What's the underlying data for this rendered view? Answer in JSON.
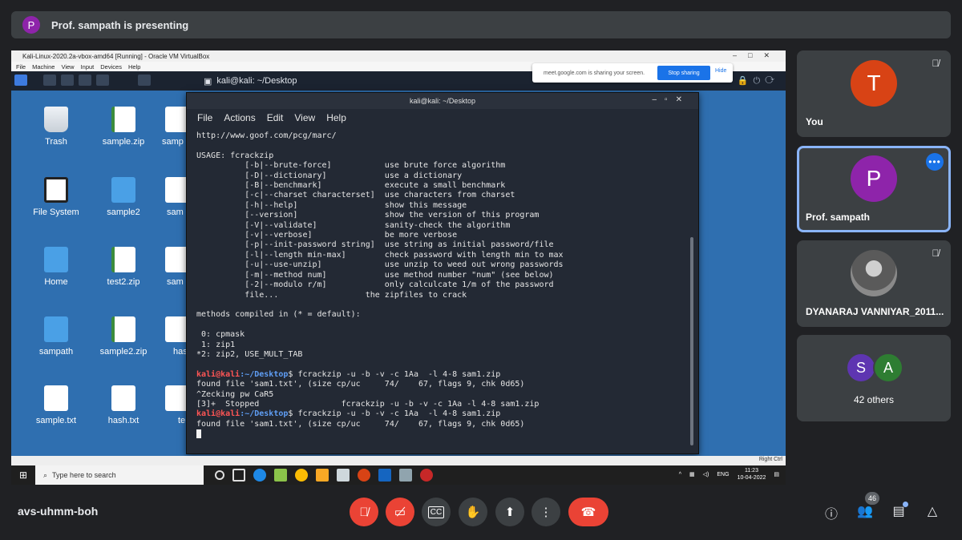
{
  "banner": {
    "avatar_letter": "P",
    "text": "Prof. sampath is presenting"
  },
  "vbox": {
    "title": "Kali-Linux-2020.2a-vbox-amd64 [Running] - Oracle VM VirtualBox",
    "menu": [
      "File",
      "Machine",
      "View",
      "Input",
      "Devices",
      "Help"
    ],
    "status_host_key": "Right Ctrl"
  },
  "kali_panel": {
    "task_title": "kali@kali: ~/Desktop"
  },
  "share_notice": {
    "text": "meet.google.com is sharing your screen.",
    "stop": "Stop sharing",
    "hide": "Hide"
  },
  "desktop_icons": [
    {
      "label": "Trash",
      "type": "trash"
    },
    {
      "label": "sample.zip",
      "type": "zip"
    },
    {
      "label": "samp",
      "type": "doc"
    },
    {
      "label": "File System",
      "type": "fs"
    },
    {
      "label": "sample2",
      "type": "folder"
    },
    {
      "label": "sam",
      "type": "doc"
    },
    {
      "label": "Home",
      "type": "home"
    },
    {
      "label": "test2.zip",
      "type": "zip"
    },
    {
      "label": "sam",
      "type": "doc"
    },
    {
      "label": "sampath",
      "type": "folder"
    },
    {
      "label": "sample2.zip",
      "type": "zip"
    },
    {
      "label": "has",
      "type": "doc"
    },
    {
      "label": "sample.txt",
      "type": "doc"
    },
    {
      "label": "hash.txt",
      "type": "doc"
    },
    {
      "label": "te",
      "type": "doc"
    }
  ],
  "terminal": {
    "title": "kali@kali: ~/Desktop",
    "menu": [
      "File",
      "Actions",
      "Edit",
      "View",
      "Help"
    ],
    "lines": [
      "http://www.goof.com/pcg/marc/",
      "",
      "USAGE: fcrackzip",
      "          [-b|--brute-force]           use brute force algorithm",
      "          [-D|--dictionary]            use a dictionary",
      "          [-B|--benchmark]             execute a small benchmark",
      "          [-c|--charset characterset]  use characters from charset",
      "          [-h|--help]                  show this message",
      "          [--version]                  show the version of this program",
      "          [-V|--validate]              sanity-check the algorithm",
      "          [-v|--verbose]               be more verbose",
      "          [-p|--init-password string]  use string as initial password/file",
      "          [-l|--length min-max]        check password with length min to max",
      "          [-u|--use-unzip]             use unzip to weed out wrong passwords",
      "          [-m|--method num]            use method number \"num\" (see below)",
      "          [-2|--modulo r/m]            only calculcate 1/m of the password",
      "          file...                  the zipfiles to crack",
      "",
      "methods compiled in (* = default):",
      "",
      " 0: cpmask",
      " 1: zip1",
      "*2: zip2, USE_MULT_TAB",
      ""
    ],
    "prompt_user": "kali@kali",
    "prompt_path": ":~/Desktop",
    "cmd1": "$ fcrackzip -u -b -v -c 1Aa  -l 4-8 sam1.zip",
    "out1": "found file 'sam1.txt', (size cp/uc     74/    67, flags 9, chk 0d65)",
    "out2": "^Zecking pw CaR5",
    "out3": "[3]+  Stopped                 fcrackzip -u -b -v -c 1Aa -l 4-8 sam1.zip",
    "cmd2": "$ fcrackzip -u -b -v -c 1Aa  -l 4-8 sam1.zip",
    "out4": "found file 'sam1.txt', (size cp/uc     74/    67, flags 9, chk 0d65)"
  },
  "taskbar": {
    "search_placeholder": "Type here to search",
    "lang": "ENG",
    "time": "11:23",
    "date": "10-04-2022"
  },
  "participants": [
    {
      "name": "You",
      "letter": "T",
      "color": "#d84315",
      "muted": true
    },
    {
      "name": "Prof. sampath",
      "letter": "P",
      "color": "#8e24aa",
      "muted": false
    },
    {
      "name": "DYANARAJ VANNIYAR_2011...",
      "letter": "",
      "color": "#5a5a5a",
      "muted": true
    }
  ],
  "others": {
    "a_letter": "S",
    "a_color": "#5e35b1",
    "b_letter": "A",
    "b_color": "#2e7d32",
    "label": "42 others"
  },
  "meeting": {
    "code": "avs-uhmm-boh",
    "participant_count": "46"
  }
}
